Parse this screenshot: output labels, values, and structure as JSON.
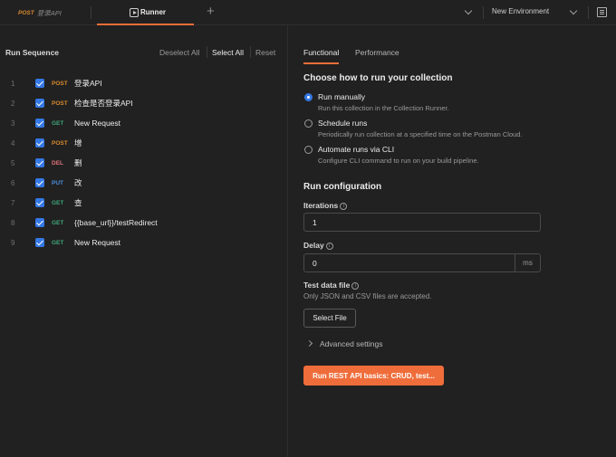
{
  "tabs": {
    "tab1": {
      "method": "POST",
      "name": "登录API"
    },
    "tab2": {
      "label": "Runner"
    },
    "new_tab_icon": "plus-icon",
    "environment": "New Environment"
  },
  "left": {
    "title": "Run Sequence",
    "deselect_all": "Deselect All",
    "select_all": "Select All",
    "reset": "Reset",
    "requests": [
      {
        "num": "1",
        "method": "POST",
        "color": "#d6892e",
        "name": "登录API"
      },
      {
        "num": "2",
        "method": "POST",
        "color": "#d6892e",
        "name": "检查是否登录API"
      },
      {
        "num": "3",
        "method": "GET",
        "color": "#3fa57a",
        "name": "New Request"
      },
      {
        "num": "4",
        "method": "POST",
        "color": "#d6892e",
        "name": "增"
      },
      {
        "num": "5",
        "method": "DEL",
        "color": "#e0707a",
        "name": "删"
      },
      {
        "num": "6",
        "method": "PUT",
        "color": "#4b8fe0",
        "name": "改"
      },
      {
        "num": "7",
        "method": "GET",
        "color": "#3fa57a",
        "name": "查"
      },
      {
        "num": "8",
        "method": "GET",
        "color": "#3fa57a",
        "name": "{{base_url}}/testRedirect"
      },
      {
        "num": "9",
        "method": "GET",
        "color": "#3fa57a",
        "name": "New Request"
      }
    ]
  },
  "right": {
    "tab_functional": "Functional",
    "tab_performance": "Performance",
    "heading": "Choose how to run your collection",
    "options": [
      {
        "label": "Run manually",
        "desc": "Run this collection in the Collection Runner.",
        "selected": true
      },
      {
        "label": "Schedule runs",
        "desc": "Periodically run collection at a specified time on the Postman Cloud.",
        "selected": false
      },
      {
        "label": "Automate runs via CLI",
        "desc": "Configure CLI command to run on your build pipeline.",
        "selected": false
      }
    ],
    "config_heading": "Run configuration",
    "iterations_label": "Iterations",
    "iterations_value": "1",
    "delay_label": "Delay",
    "delay_value": "0",
    "delay_unit": "ms",
    "testdata_label": "Test data file",
    "testdata_hint": "Only JSON and CSV files are accepted.",
    "select_file": "Select File",
    "advanced": "Advanced settings",
    "run_button": "Run REST API basics: CRUD, test..."
  }
}
